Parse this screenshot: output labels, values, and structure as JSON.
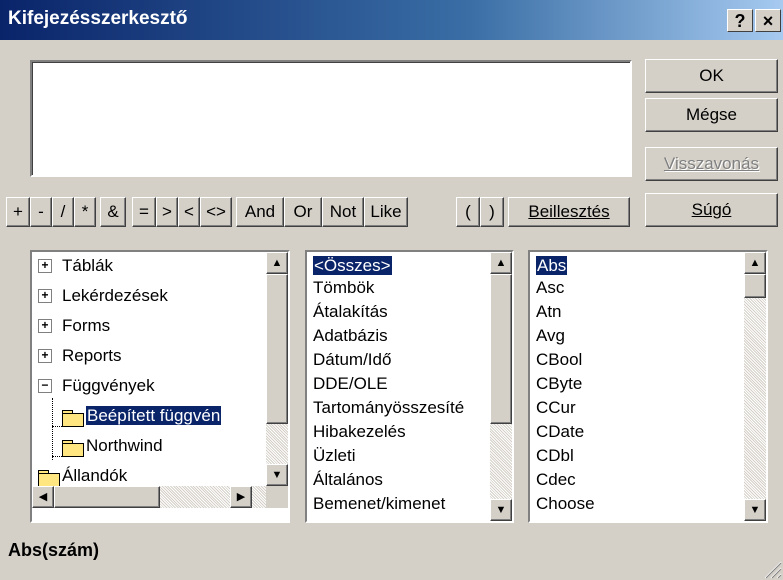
{
  "window": {
    "title": "Kifejezésszerkesztő",
    "help_label": "?",
    "close_label": "×"
  },
  "expression": {
    "value": ""
  },
  "buttons": {
    "ok": "OK",
    "cancel": "Mégse",
    "undo": "Visszavonás",
    "paste": "Beillesztés",
    "help": "Súgó"
  },
  "operators": [
    "+",
    "-",
    "/",
    "*",
    "&",
    "=",
    ">",
    "<",
    "<>",
    "And",
    "Or",
    "Not",
    "Like",
    "(",
    ")"
  ],
  "tree": {
    "items": [
      {
        "label": "Táblák",
        "expand": "+"
      },
      {
        "label": "Lekérdezések",
        "expand": "+"
      },
      {
        "label": "Forms",
        "expand": "+"
      },
      {
        "label": "Reports",
        "expand": "+"
      },
      {
        "label": "Függvények",
        "expand": "−"
      },
      {
        "label": "Beépített függvén",
        "expand": ""
      },
      {
        "label": "Northwind",
        "expand": ""
      },
      {
        "label": "Állandók",
        "expand": ""
      }
    ],
    "selected": "Beépített függvén"
  },
  "categories": {
    "items": [
      "<Összes>",
      "Tömbök",
      "Átalakítás",
      "Adatbázis",
      "Dátum/Idő",
      "DDE/OLE",
      "Tartományösszesíté",
      "Hibakezelés",
      "Üzleti",
      "Általános",
      "Bemenet/kimenet"
    ],
    "selected": "<Összes>"
  },
  "functions": {
    "items": [
      "Abs",
      "Asc",
      "Atn",
      "Avg",
      "CBool",
      "CByte",
      "CCur",
      "CDate",
      "CDbl",
      "Cdec",
      "Choose"
    ],
    "selected": "Abs"
  },
  "status": {
    "syntax": "Abs(szám)"
  },
  "colors": {
    "selection": "#0a246a",
    "title_bar": "#0a246a",
    "face": "#d4d0c8"
  }
}
